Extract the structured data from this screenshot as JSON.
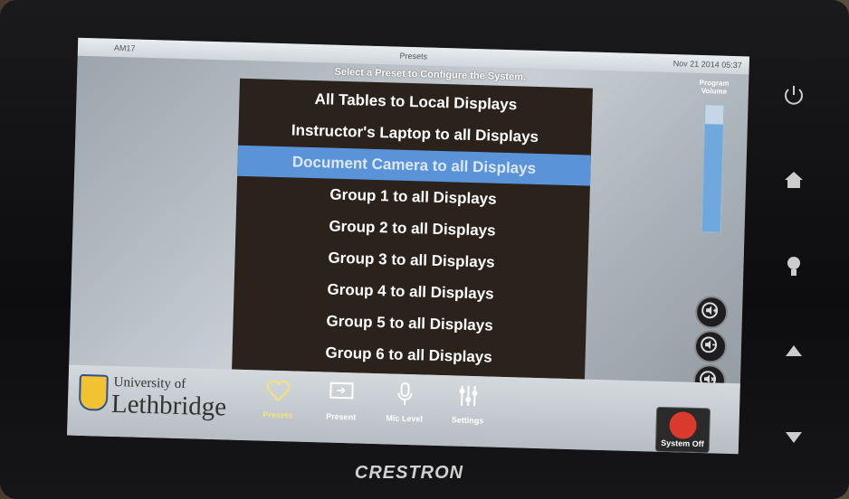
{
  "topbar": {
    "left": "AM17",
    "title": "Presets",
    "datetime": "Nov 21 2014 05:37"
  },
  "subtitle": "Select a Preset to Configure the System.",
  "presets": [
    "All Tables to Local Displays",
    "Instructor's Laptop to all Displays",
    "Document Camera to all Displays",
    "Group 1 to all Displays",
    "Group 2 to all Displays",
    "Group 3 to all Displays",
    "Group 4 to all Displays",
    "Group 5 to all Displays",
    "Group 6 to all Displays"
  ],
  "selected_index": 2,
  "logo": {
    "line1": "University of",
    "line2": "Lethbridge"
  },
  "nav": [
    {
      "label": "Presets",
      "icon": "heart-icon",
      "active": true
    },
    {
      "label": "Present",
      "icon": "monitor-icon",
      "active": false
    },
    {
      "label": "Mic Level",
      "icon": "microphone-icon",
      "active": false
    },
    {
      "label": "Settings",
      "icon": "sliders-icon",
      "active": false
    }
  ],
  "system_off": {
    "label": "System Off",
    "icon": "power-icon"
  },
  "volume": {
    "label": "Program Volume",
    "level": 0.85
  },
  "volume_buttons": [
    "volume-up-icon",
    "volume-down-icon",
    "mute-icon"
  ],
  "hardware_buttons": [
    "power-icon",
    "home-icon",
    "lightbulb-icon",
    "arrow-up-icon",
    "arrow-down-icon"
  ],
  "brand": "CRESTRON",
  "colors": {
    "selected": "#5b93d9",
    "list_bg": "#2b221c",
    "power": "#d93a2b",
    "volume_fill": "#6ea8dd"
  }
}
